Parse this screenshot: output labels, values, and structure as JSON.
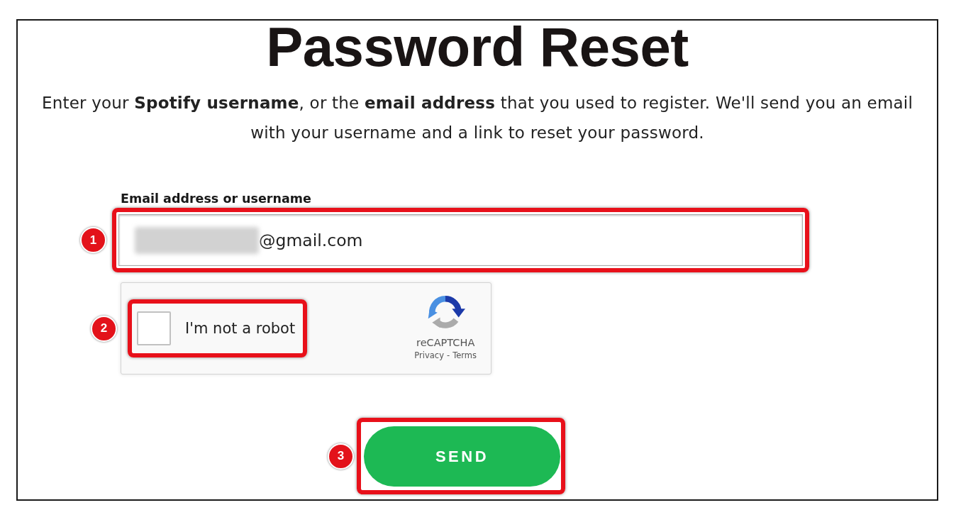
{
  "heading": "Password Reset",
  "intro": "Enter your **Spotify username**, or the **email address** that you used to register. We'll send you an email with your username and a link to reset your password.",
  "email_field": {
    "label": "Email address or username",
    "value": "@gmail.com",
    "redacted": true,
    "step": "1",
    "highlighted": true
  },
  "captcha": {
    "label": "I'm not a robot",
    "checked": false,
    "brand": "reCAPTCHA",
    "privacy_link": "Privacy",
    "separator": "-",
    "terms_link": "Terms",
    "step": "2",
    "highlighted": true
  },
  "send_button": {
    "label": "SEND",
    "step": "3",
    "highlighted": true
  }
}
